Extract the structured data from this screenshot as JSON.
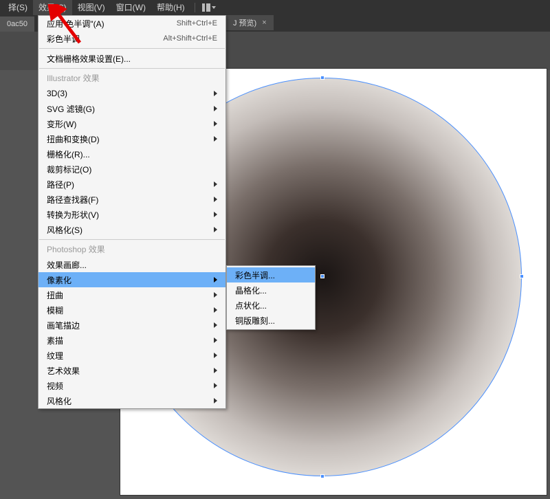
{
  "menubar": {
    "items": [
      "择(S)",
      "效果(C)",
      "视图(V)",
      "窗口(W)",
      "帮助(H)"
    ]
  },
  "tab": {
    "prefix": "0ac50",
    "label": "J 预览)",
    "close": "×"
  },
  "dropdown": {
    "top": [
      {
        "label": "应用  色半调\"(A)",
        "shortcut": "Shift+Ctrl+E"
      },
      {
        "label": "彩色半调",
        "shortcut": "Alt+Shift+Ctrl+E"
      }
    ],
    "docGrid": {
      "label": "文档栅格效果设置(E)..."
    },
    "illustratorHeader": "Illustrator 效果",
    "illustratorItems": [
      {
        "label": "3D(3)",
        "arrow": true
      },
      {
        "label": "SVG 滤镜(G)",
        "arrow": true
      },
      {
        "label": "变形(W)",
        "arrow": true
      },
      {
        "label": "扭曲和变换(D)",
        "arrow": true
      },
      {
        "label": "栅格化(R)..."
      },
      {
        "label": "裁剪标记(O)"
      },
      {
        "label": "路径(P)",
        "arrow": true
      },
      {
        "label": "路径查找器(F)",
        "arrow": true
      },
      {
        "label": "转换为形状(V)",
        "arrow": true
      },
      {
        "label": "风格化(S)",
        "arrow": true
      }
    ],
    "photoshopHeader": "Photoshop 效果",
    "photoshopItems": [
      {
        "label": "效果画廊..."
      },
      {
        "label": "像素化",
        "arrow": true,
        "highlighted": true
      },
      {
        "label": "扭曲",
        "arrow": true
      },
      {
        "label": "模糊",
        "arrow": true
      },
      {
        "label": "画笔描边",
        "arrow": true
      },
      {
        "label": "素描",
        "arrow": true
      },
      {
        "label": "纹理",
        "arrow": true
      },
      {
        "label": "艺术效果",
        "arrow": true
      },
      {
        "label": "视频",
        "arrow": true
      },
      {
        "label": "风格化",
        "arrow": true
      }
    ]
  },
  "submenu": {
    "items": [
      {
        "label": "彩色半调...",
        "highlighted": true
      },
      {
        "label": "晶格化..."
      },
      {
        "label": "点状化..."
      },
      {
        "label": "铜版雕刻..."
      }
    ]
  }
}
